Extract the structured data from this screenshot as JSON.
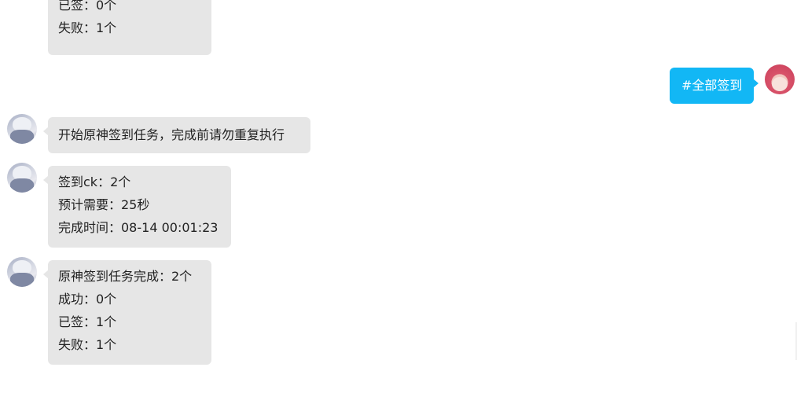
{
  "messages": [
    {
      "lines": [
        "已签：0个",
        "失败：1个"
      ]
    },
    {
      "lines": [
        "#全部签到"
      ]
    },
    {
      "lines": [
        "开始原神签到任务，完成前请勿重复执行"
      ]
    },
    {
      "lines": [
        "签到ck：2个",
        "预计需要：25秒",
        "完成时间：08-14 00:01:23"
      ]
    },
    {
      "lines": [
        "原神签到任务完成：2个",
        "成功：0个",
        "已签：1个",
        "失败：1个"
      ]
    }
  ],
  "colors": {
    "bot_bubble": "#e6e6e6",
    "user_bubble": "#12b7f5",
    "background": "#ffffff"
  }
}
